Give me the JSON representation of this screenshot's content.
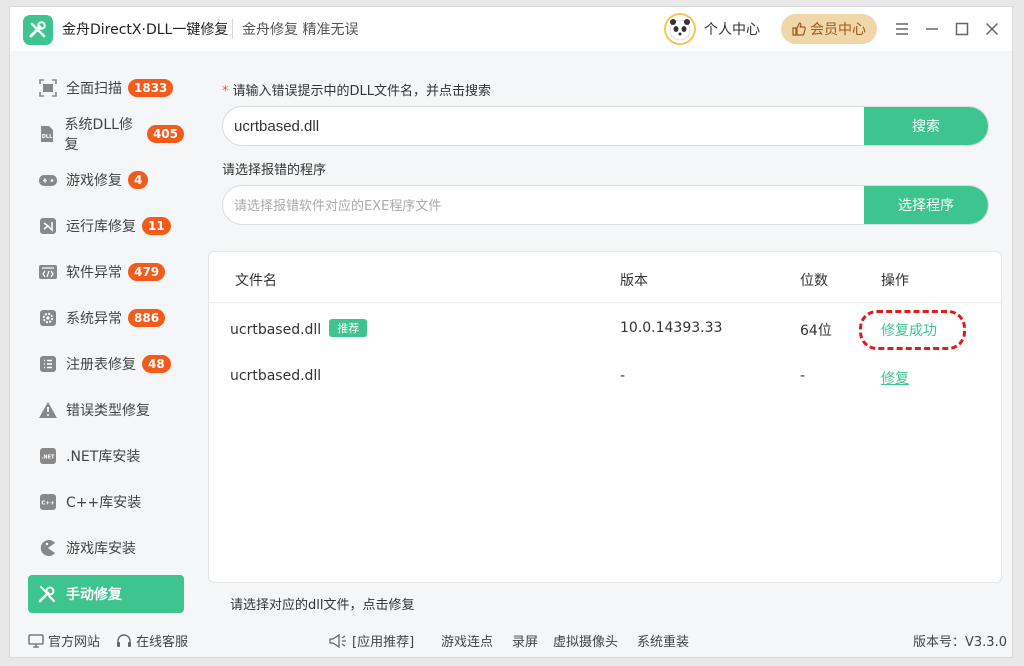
{
  "app": {
    "title": "金舟DirectX·DLL一键修复",
    "slogan": "金舟修复 精准无误",
    "user_center": "个人中心",
    "vip_center": "会员中心"
  },
  "sidebar": {
    "items": [
      {
        "label": "全面扫描",
        "badge": "1833",
        "icon": "scan-icon"
      },
      {
        "label": "系统DLL修复",
        "badge": "405",
        "icon": "dll-icon"
      },
      {
        "label": "游戏修复",
        "badge": "4",
        "icon": "gamepad-icon"
      },
      {
        "label": "运行库修复",
        "badge": "11",
        "icon": "visual-studio-icon"
      },
      {
        "label": "软件异常",
        "badge": "479",
        "icon": "code-window-icon"
      },
      {
        "label": "系统异常",
        "badge": "886",
        "icon": "gear-icon"
      },
      {
        "label": "注册表修复",
        "badge": "48",
        "icon": "list-icon"
      },
      {
        "label": "错误类型修复",
        "badge": "",
        "icon": "warning-icon"
      },
      {
        "label": ".NET库安装",
        "badge": "",
        "icon": "dotnet-icon"
      },
      {
        "label": "C++库安装",
        "badge": "",
        "icon": "cpp-icon"
      },
      {
        "label": "游戏库安装",
        "badge": "",
        "icon": "pacman-icon"
      },
      {
        "label": "手动修复",
        "badge": "",
        "icon": "wrench-icon"
      }
    ]
  },
  "search": {
    "label_required": "*",
    "label": "请输入错误提示中的DLL文件名，并点击搜索",
    "value": "ucrtbased.dll",
    "button": "搜索"
  },
  "program": {
    "label": "请选择报错的程序",
    "placeholder": "请选择报错软件对应的EXE程序文件",
    "button": "选择程序"
  },
  "table": {
    "headers": [
      "文件名",
      "版本",
      "位数",
      "操作"
    ],
    "rows": [
      {
        "file": "ucrtbased.dll",
        "tag": "推荐",
        "version": "10.0.14393.33",
        "bits": "64位",
        "action": "修复成功"
      },
      {
        "file": "ucrtbased.dll",
        "tag": "",
        "version": "-",
        "bits": "-",
        "action": "修复"
      }
    ]
  },
  "hint": "请选择对应的dll文件，点击修复",
  "footer": {
    "website": "官方网站",
    "support": "在线客服",
    "app_recommend": "[应用推荐]",
    "links": [
      "游戏连点",
      "录屏",
      "虚拟摄像头",
      "系统重装"
    ],
    "version": "版本号：V3.3.0"
  },
  "colors": {
    "accent": "#3ec48f",
    "badge": "#f35b1c",
    "highlight_ring": "#e01b1b"
  }
}
